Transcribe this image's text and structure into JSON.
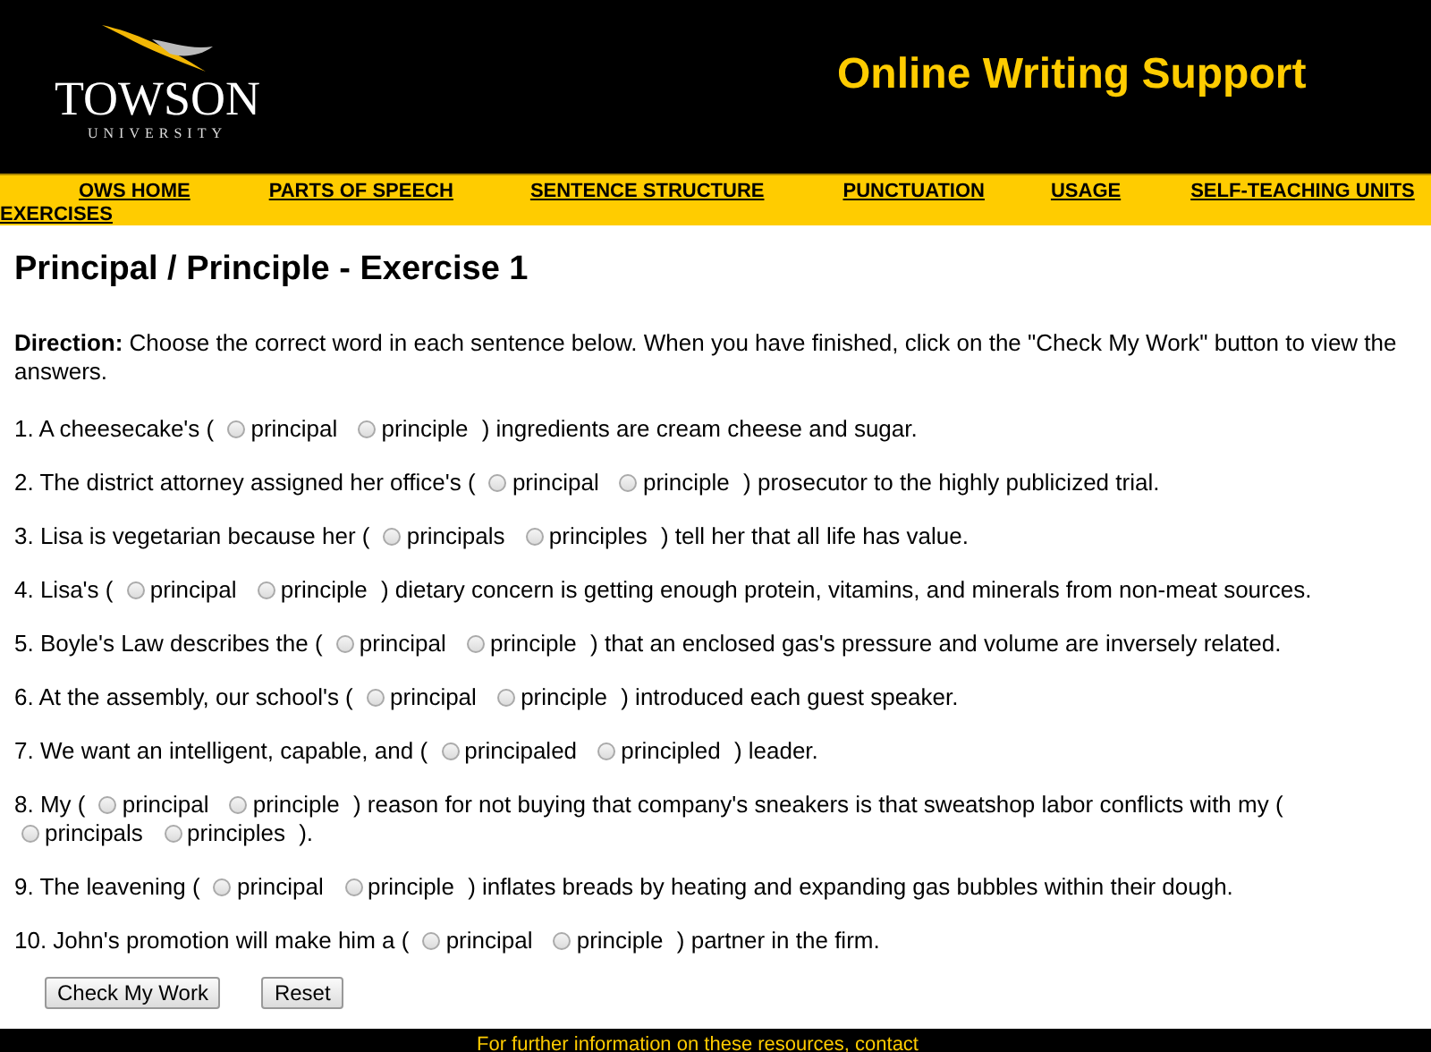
{
  "header": {
    "logo_name": "TOWSON",
    "logo_sub": "UNIVERSITY",
    "site_title": "Online Writing Support"
  },
  "nav": [
    "OWS HOME",
    "PARTS OF SPEECH",
    "SENTENCE STRUCTURE",
    "PUNCTUATION",
    "USAGE",
    "SELF-TEACHING UNITS",
    "EXERCISES"
  ],
  "page_title": "Principal / Principle - Exercise 1",
  "direction": "**Direction:** Choose the correct word in each sentence below. When you have finished, click on the \"Check My Work\" button to view the answers.",
  "questions": [
    {
      "parts": [
        {
          "kind": "text",
          "text": "1. A cheesecake's ("
        },
        {
          "kind": "choice",
          "options": [
            {
              "label": "principal",
              "selected": false
            },
            {
              "label": "principle",
              "selected": false
            }
          ]
        },
        {
          "kind": "text",
          "text": ") ingredients are cream cheese and sugar."
        }
      ]
    },
    {
      "parts": [
        {
          "kind": "text",
          "text": "2. The district attorney assigned her office's ("
        },
        {
          "kind": "choice",
          "options": [
            {
              "label": "principal",
              "selected": false
            },
            {
              "label": "principle",
              "selected": false
            }
          ]
        },
        {
          "kind": "text",
          "text": ") prosecutor to the highly publicized trial."
        }
      ]
    },
    {
      "parts": [
        {
          "kind": "text",
          "text": "3. Lisa is vegetarian because her ("
        },
        {
          "kind": "choice",
          "options": [
            {
              "label": "principals",
              "selected": false
            },
            {
              "label": "principles",
              "selected": false
            }
          ]
        },
        {
          "kind": "text",
          "text": ") tell her that all life has value."
        }
      ]
    },
    {
      "parts": [
        {
          "kind": "text",
          "text": "4. Lisa's ("
        },
        {
          "kind": "choice",
          "options": [
            {
              "label": "principal",
              "selected": false
            },
            {
              "label": "principle",
              "selected": false
            }
          ]
        },
        {
          "kind": "text",
          "text": ") dietary concern is getting enough protein, vitamins, and minerals from non-meat sources."
        }
      ]
    },
    {
      "parts": [
        {
          "kind": "text",
          "text": "5. Boyle's Law describes the ("
        },
        {
          "kind": "choice",
          "options": [
            {
              "label": "principal",
              "selected": false
            },
            {
              "label": "principle",
              "selected": false
            }
          ]
        },
        {
          "kind": "text",
          "text": ") that an enclosed gas's pressure and volume are inversely related."
        }
      ]
    },
    {
      "parts": [
        {
          "kind": "text",
          "text": "6. At the assembly, our school's ("
        },
        {
          "kind": "choice",
          "options": [
            {
              "label": "principal",
              "selected": false
            },
            {
              "label": "principle",
              "selected": false
            }
          ]
        },
        {
          "kind": "text",
          "text": ") introduced each guest speaker."
        }
      ]
    },
    {
      "parts": [
        {
          "kind": "text",
          "text": "7. We want an intelligent, capable, and ("
        },
        {
          "kind": "choice",
          "options": [
            {
              "label": "principaled",
              "selected": false
            },
            {
              "label": "principled",
              "selected": false
            }
          ]
        },
        {
          "kind": "text",
          "text": ") leader."
        }
      ]
    },
    {
      "parts": [
        {
          "kind": "text",
          "text": "8. My ("
        },
        {
          "kind": "choice",
          "options": [
            {
              "label": "principal",
              "selected": false
            },
            {
              "label": "principle",
              "selected": false
            }
          ]
        },
        {
          "kind": "text",
          "text": ") reason for not buying that company's sneakers is that sweatshop labor conflicts with my ("
        },
        {
          "kind": "choice",
          "options": [
            {
              "label": "principals",
              "selected": false
            },
            {
              "label": "principles",
              "selected": false
            }
          ]
        },
        {
          "kind": "text",
          "text": ")."
        }
      ]
    },
    {
      "parts": [
        {
          "kind": "text",
          "text": "9. The leavening ("
        },
        {
          "kind": "choice",
          "options": [
            {
              "label": "principal",
              "selected": false
            },
            {
              "label": "principle",
              "selected": false
            }
          ]
        },
        {
          "kind": "text",
          "text": ") inflates breads by heating and expanding gas bubbles within their dough."
        }
      ]
    },
    {
      "parts": [
        {
          "kind": "text",
          "text": "10. John's promotion will make him a ("
        },
        {
          "kind": "choice",
          "options": [
            {
              "label": "principal",
              "selected": false
            },
            {
              "label": "principle",
              "selected": false
            }
          ]
        },
        {
          "kind": "text",
          "text": ") partner in the firm."
        }
      ]
    }
  ],
  "buttons": [
    "Check My Work",
    "Reset"
  ],
  "footer": "For further information on these resources, contact"
}
